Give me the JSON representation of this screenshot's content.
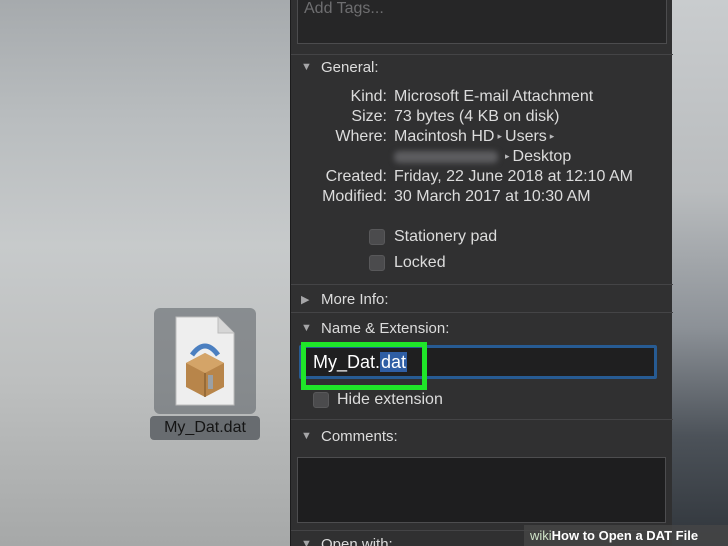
{
  "tags": {
    "placeholder": "Add Tags..."
  },
  "general": {
    "header": "General:",
    "rows": [
      {
        "label": "Kind:",
        "value": "Microsoft E-mail Attachment"
      },
      {
        "label": "Size:",
        "value": "73 bytes (4 KB on disk)"
      },
      {
        "label": "Where:",
        "value_parts": [
          "Macintosh HD",
          "Users"
        ]
      },
      {
        "label": "",
        "value": "Desktop"
      },
      {
        "label": "Created:",
        "value": "Friday, 22 June 2018 at 12:10 AM"
      },
      {
        "label": "Modified:",
        "value": "30 March 2017 at 10:30 AM"
      }
    ],
    "stationery_label": "Stationery pad",
    "locked_label": "Locked"
  },
  "more_info": {
    "header": "More Info:"
  },
  "name_ext": {
    "header": "Name & Extension:",
    "name": "My_Dat.",
    "extension": "dat",
    "hide_extension_label": "Hide extension"
  },
  "comments": {
    "header": "Comments:"
  },
  "open_with": {
    "header": "Open with:"
  },
  "desktop_file": {
    "name": "My_Dat.dat"
  },
  "watermark": {
    "wiki": "wiki",
    "text": "How to Open a DAT File"
  },
  "colors": {
    "highlight": "#1fe629",
    "selection": "#2f5ea4",
    "focus_ring": "#275b93"
  }
}
